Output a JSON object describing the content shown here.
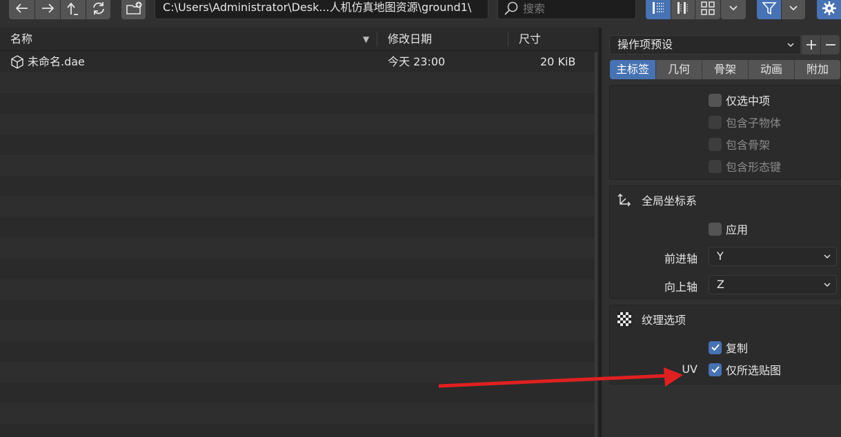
{
  "toolbar": {
    "back_icon": "arrow-left-icon",
    "forward_icon": "arrow-right-icon",
    "parent_icon": "parent-directory-icon",
    "refresh_icon": "refresh-icon",
    "new_folder_icon": "new-folder-icon",
    "path": "C:\\Users\\Administrator\\Desk...人机仿真地图资源\\ground1\\",
    "search_placeholder": "搜索"
  },
  "columns": {
    "name": "名称",
    "date": "修改日期",
    "size": "尺寸"
  },
  "files": [
    {
      "name": "未命名.dae",
      "date": "今天 23:00",
      "size": "20 KiB"
    }
  ],
  "panel": {
    "preset": "操作项预设",
    "tabs": [
      {
        "label": "主标签",
        "active": true
      },
      {
        "label": "几何",
        "active": false
      },
      {
        "label": "骨架",
        "active": false
      },
      {
        "label": "动画",
        "active": false
      },
      {
        "label": "附加",
        "active": false
      }
    ],
    "main": {
      "selected_only": "仅选中项",
      "include_children": "包含子物体",
      "include_armatures": "包含骨架",
      "include_shape_keys": "包含形态键"
    },
    "global_orientation": {
      "title": "全局坐标系",
      "apply": "应用",
      "forward_axis_label": "前进轴",
      "forward_axis_value": "Y",
      "up_axis_label": "向上轴",
      "up_axis_value": "Z"
    },
    "texture_options": {
      "title": "纹理选项",
      "copy": "复制",
      "uv_label": "UV",
      "only_selected_map": "仅所选贴图"
    }
  },
  "colors": {
    "accent": "#4772b3",
    "annotation_arrow": "#e02020"
  }
}
